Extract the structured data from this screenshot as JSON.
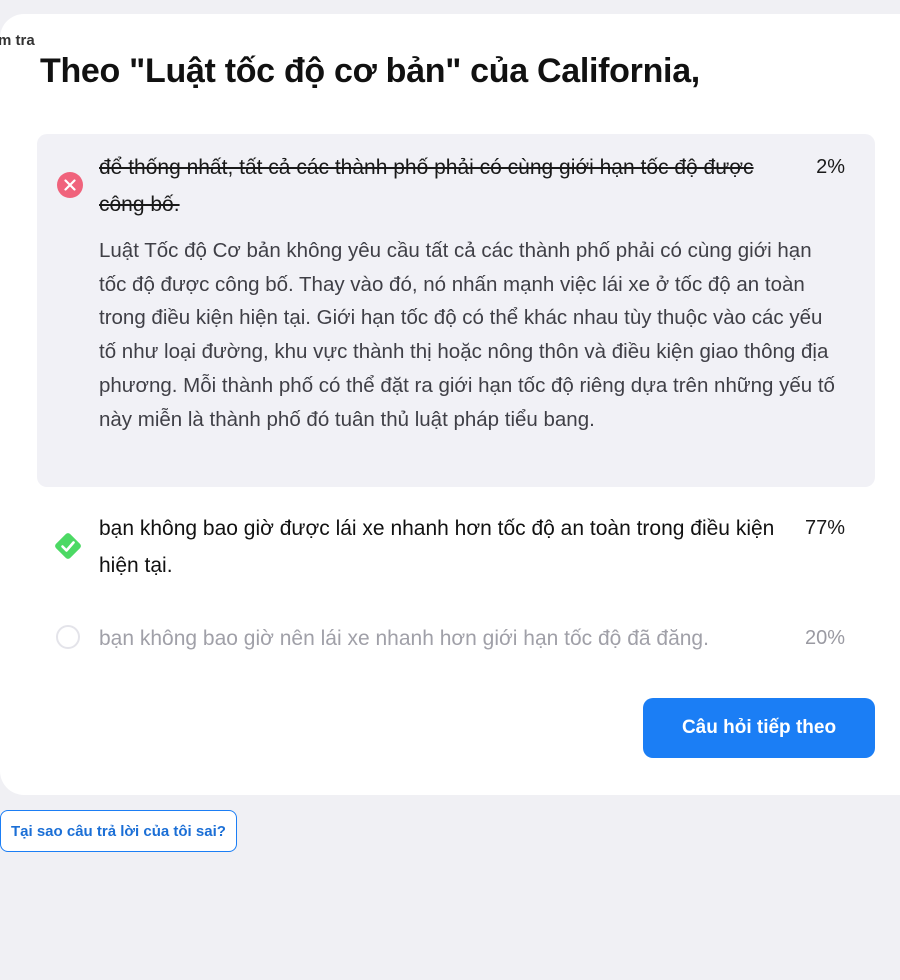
{
  "header": {
    "tag_label": "m tra",
    "question": "Theo \"Luật tốc độ cơ bản\" của California,"
  },
  "options": [
    {
      "text": "để thống nhất, tất cả các thành phố phải có cùng giới hạn tốc độ được công bố.",
      "percent": "2%",
      "state": "wrong",
      "icon": "x-circle-icon",
      "explanation": "Luật Tốc độ Cơ bản không yêu cầu tất cả các thành phố phải có cùng giới hạn tốc độ được công bố. Thay vào đó, nó nhấn mạnh việc lái xe ở tốc độ an toàn trong điều kiện hiện tại. Giới hạn tốc độ có thể khác nhau tùy thuộc vào các yếu tố như loại đường, khu vực thành thị hoặc nông thôn và điều kiện giao thông địa phương. Mỗi thành phố có thể đặt ra giới hạn tốc độ riêng dựa trên những yếu tố này miễn là thành phố đó tuân thủ luật pháp tiểu bang."
    },
    {
      "text": "bạn không bao giờ được lái xe nhanh hơn tốc độ an toàn trong điều kiện hiện tại.",
      "percent": "77%",
      "state": "correct",
      "icon": "check-diamond-icon"
    },
    {
      "text": "bạn không bao giờ nên lái xe nhanh hơn giới hạn tốc độ đã đăng.",
      "percent": "20%",
      "state": "unselected",
      "icon": "radio-circle-icon"
    }
  ],
  "actions": {
    "next_label": "Câu hỏi tiếp theo",
    "why_label": "Tại sao câu trả lời của tôi sai?"
  },
  "colors": {
    "accent": "#1b7ef5",
    "wrong": "#f0637c",
    "correct": "#4cd964",
    "background": "#f0f0f4"
  }
}
